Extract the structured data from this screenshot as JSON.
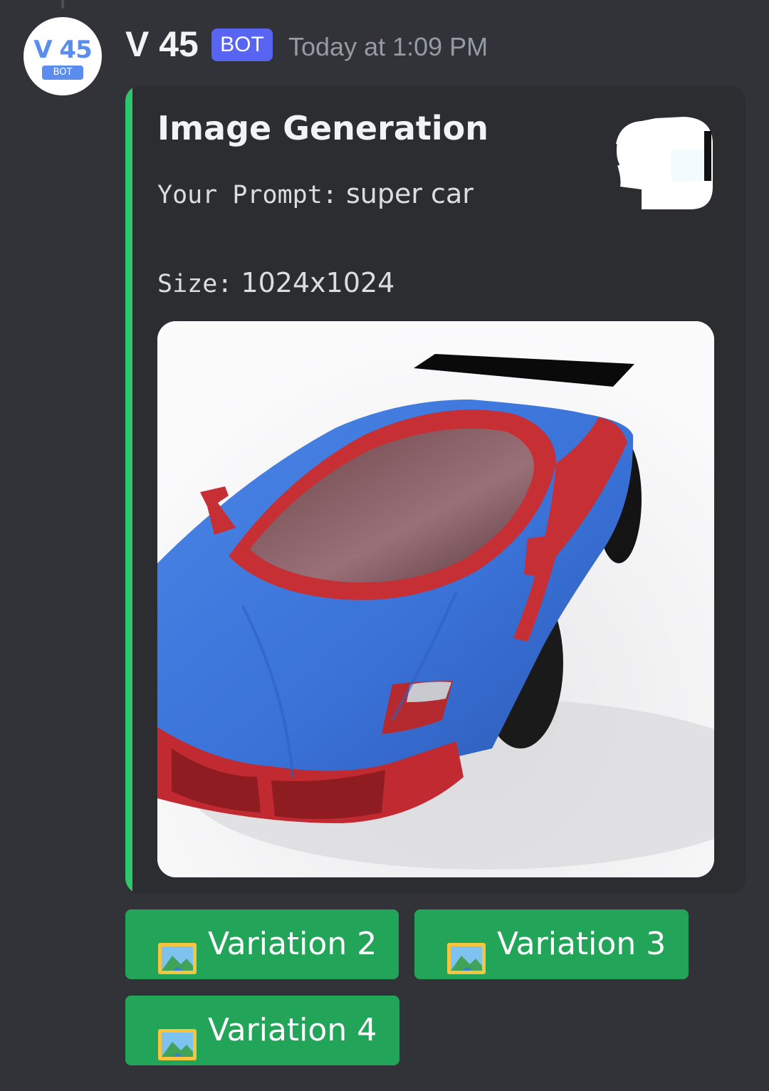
{
  "message": {
    "avatar": {
      "name": "V 45",
      "badge": "BOT"
    },
    "author": "V 45",
    "bot_tag": "BOT",
    "timestamp": "Today at 1:09 PM"
  },
  "embed": {
    "accent_color": "#2dc770",
    "title": "Image Generation",
    "prompt_label": "Your Prompt:",
    "prompt_value": "super car",
    "size_label": "Size:",
    "size_value": "1024x1024",
    "image_icon": "generated-image",
    "thumbnail_icon": "bot-thumbnail"
  },
  "buttons": [
    {
      "label": "Variation 2",
      "icon": "framed-picture-icon"
    },
    {
      "label": "Variation 3",
      "icon": "framed-picture-icon"
    },
    {
      "label": "Variation 4",
      "icon": "framed-picture-icon"
    }
  ],
  "colors": {
    "background": "#313338",
    "embed_background": "#2b2d31",
    "button_green": "#23a559",
    "bot_tag": "#5865f2",
    "avatar_text": "#5b8def"
  }
}
